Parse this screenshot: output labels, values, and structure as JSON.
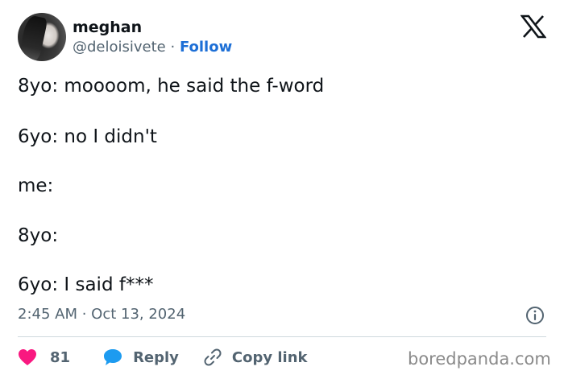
{
  "author": {
    "name": "meghan",
    "handle": "@deloisivete",
    "separator": " · ",
    "follow_label": "Follow"
  },
  "tweet": {
    "lines": [
      "8yo: moooom, he said the f-word",
      "6yo: no I didn't",
      "me:",
      "8yo:",
      "6yo: I said f***"
    ],
    "timestamp": "2:45 AM · Oct 13, 2024"
  },
  "actions": {
    "like_count": "81",
    "reply_label": "Reply",
    "copy_link_label": "Copy link"
  },
  "watermark": "boredpanda.com",
  "colors": {
    "text": "#0f1419",
    "secondary": "#536471",
    "follow": "#1d6fd6",
    "like": "#f91880",
    "reply": "#1d9bf0",
    "divider": "#cfd9de"
  },
  "icons": [
    "x-logo-icon",
    "info-icon",
    "heart-icon",
    "reply-bubble-icon",
    "link-icon"
  ]
}
